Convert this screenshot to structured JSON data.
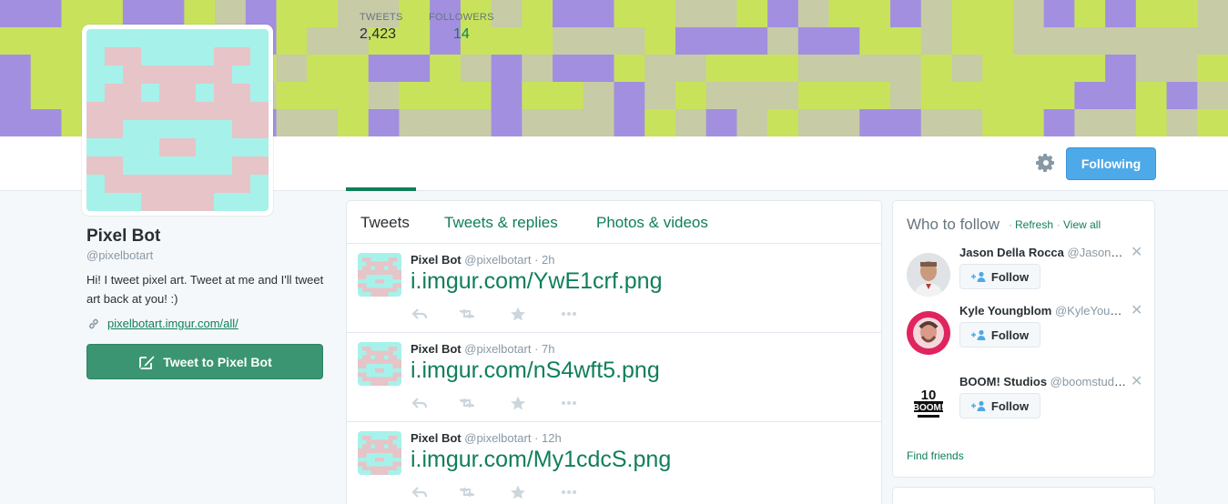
{
  "profile": {
    "name": "Pixel Bot",
    "handle": "@pixelbotart",
    "bio": "Hi! I tweet pixel art. Tweet at me and I'll tweet art back at you! :)",
    "link_text": "pixelbotart.imgur.com/all/",
    "tweet_to_label": "Tweet to Pixel Bot"
  },
  "stats": {
    "tweets_label": "TWEETS",
    "tweets_value": "2,423",
    "followers_label": "FOLLOWERS",
    "followers_value": "14"
  },
  "header": {
    "following_label": "Following",
    "gear_icon": "gear-icon"
  },
  "timeline": {
    "tabs": [
      {
        "label": "Tweets"
      },
      {
        "label": "Tweets & replies"
      },
      {
        "label": "Photos & videos"
      }
    ],
    "tweets": [
      {
        "name": "Pixel Bot",
        "handle": "@pixelbotart",
        "dot": "·",
        "time": "2h",
        "link": "i.imgur.com/YwE1crf.png"
      },
      {
        "name": "Pixel Bot",
        "handle": "@pixelbotart",
        "dot": "·",
        "time": "7h",
        "link": "i.imgur.com/nS4wft5.png"
      },
      {
        "name": "Pixel Bot",
        "handle": "@pixelbotart",
        "dot": "·",
        "time": "12h",
        "link": "i.imgur.com/My1cdcS.png"
      }
    ]
  },
  "who_to_follow": {
    "title": "Who to follow",
    "dot": "·",
    "refresh": "Refresh",
    "view_all": "View all",
    "follow_label": "Follow",
    "close": "✕",
    "find_friends": "Find friends",
    "suggestions": [
      {
        "name": "Jason Della Rocca",
        "handle": "@JasonDellaRocca"
      },
      {
        "name": "Kyle Youngblom",
        "handle": "@KyleYoungblom"
      },
      {
        "name": "BOOM! Studios",
        "handle": "@boomstudios"
      }
    ],
    "boom_logo_text": "10 YEARS BOOM! STUDIOS"
  },
  "colors": {
    "accent": "#0f7f5a",
    "following_blue": "#4ea9e8",
    "banner_lime": "#c8e35b",
    "banner_purple": "#a28fe0",
    "banner_sage": "#c7cba6",
    "avatar_cyan": "#a6f2ea",
    "avatar_pink": "#e6c4c8"
  }
}
